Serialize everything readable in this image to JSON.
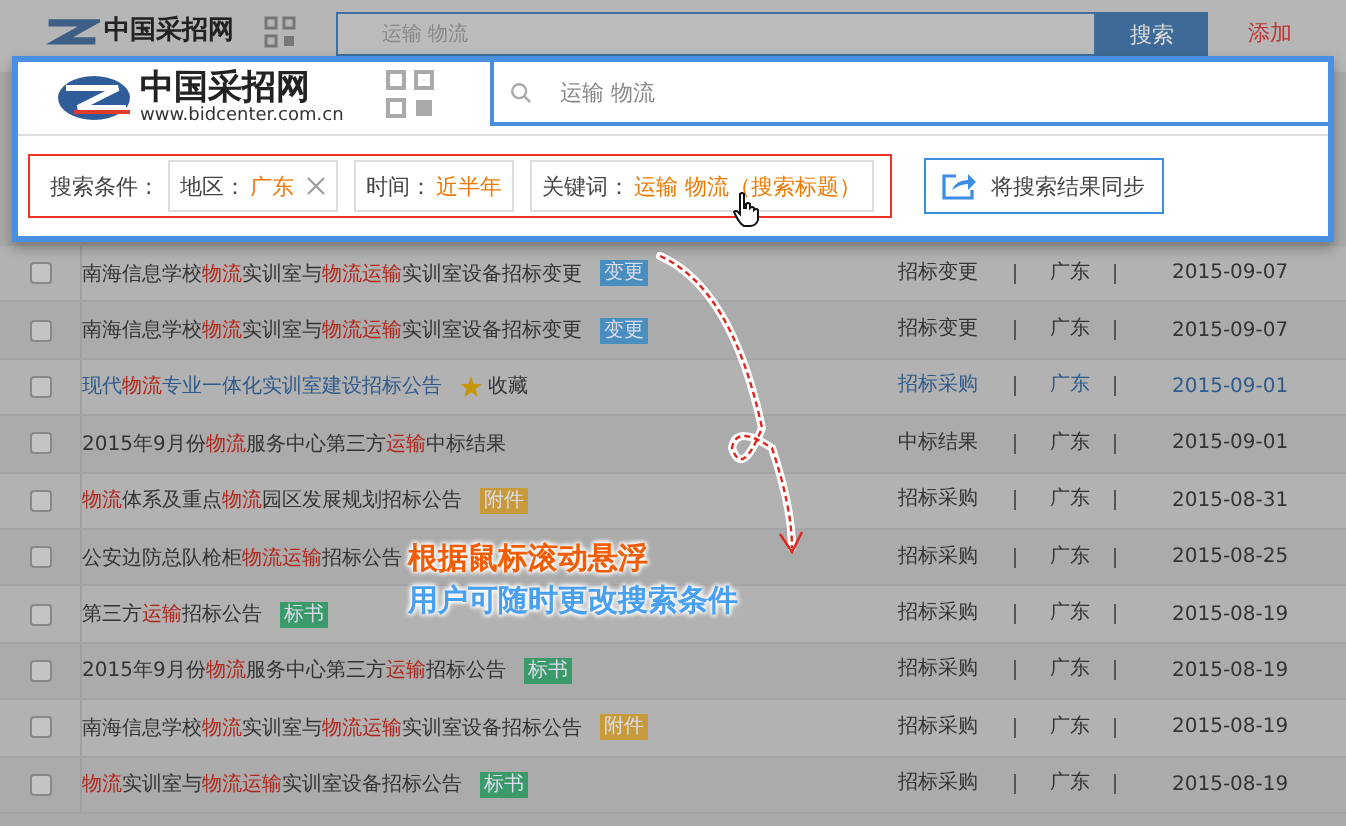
{
  "background_header": {
    "logo": "中国采招网",
    "search_value": "运输 物流",
    "search_button": "搜索",
    "link": "添加"
  },
  "floating_bar": {
    "logo_title": "中国采招网",
    "logo_url": "www.bidcenter.com.cn",
    "search_value": "运输 物流",
    "filter_label": "搜索条件 :",
    "filters": [
      {
        "label": "地区：",
        "value": "广东",
        "removable": true
      },
      {
        "label": "时间：",
        "value": "近半年",
        "removable": false
      },
      {
        "label": "关键词：",
        "value": "运输 物流（搜索标题）",
        "removable": false
      }
    ],
    "sync_button": "将搜索结果同步"
  },
  "rows": [
    {
      "checked": false,
      "highlighted": false,
      "title": [
        {
          "text": "南海信息学校",
          "highlight": false
        },
        {
          "text": "物流",
          "highlight": true
        },
        {
          "text": "实训室与",
          "highlight": false
        },
        {
          "text": "物流运输",
          "highlight": true
        },
        {
          "text": "实训室设备招标变更",
          "highlight": false
        }
      ],
      "tag": {
        "kind": "change",
        "text": "变更"
      },
      "type": "招标变更",
      "region": "广东",
      "date": "2015-09-07"
    },
    {
      "checked": false,
      "highlighted": false,
      "title": [
        {
          "text": "南海信息学校",
          "highlight": false
        },
        {
          "text": "物流",
          "highlight": true
        },
        {
          "text": "实训室与",
          "highlight": false
        },
        {
          "text": "物流运输",
          "highlight": true
        },
        {
          "text": "实训室设备招标变更",
          "highlight": false
        }
      ],
      "tag": {
        "kind": "change",
        "text": "变更"
      },
      "type": "招标变更",
      "region": "广东",
      "date": "2015-09-07"
    },
    {
      "checked": false,
      "highlighted": true,
      "title": [
        {
          "text": "现代",
          "highlight": false
        },
        {
          "text": "物流",
          "highlight": true
        },
        {
          "text": "专业一体化实训室建设招标公告",
          "highlight": false
        }
      ],
      "favorite": "收藏",
      "type": "招标采购",
      "region": "广东",
      "date": "2015-09-01"
    },
    {
      "checked": false,
      "highlighted": false,
      "title": [
        {
          "text": "2015年9月份",
          "highlight": false
        },
        {
          "text": "物流",
          "highlight": true
        },
        {
          "text": "服务中心第三方",
          "highlight": false
        },
        {
          "text": "运输",
          "highlight": true
        },
        {
          "text": "中标结果",
          "highlight": false
        }
      ],
      "type": "中标结果",
      "region": "广东",
      "date": "2015-09-01"
    },
    {
      "checked": false,
      "highlighted": false,
      "title": [
        {
          "text": "物流",
          "highlight": true
        },
        {
          "text": "体系及重点",
          "highlight": false
        },
        {
          "text": "物流",
          "highlight": true
        },
        {
          "text": "园区发展规划招标公告",
          "highlight": false
        }
      ],
      "tag": {
        "kind": "attachment",
        "text": "附件"
      },
      "type": "招标采购",
      "region": "广东",
      "date": "2015-08-31"
    },
    {
      "checked": false,
      "highlighted": false,
      "title": [
        {
          "text": "公安边防总队枪柜",
          "highlight": false
        },
        {
          "text": "物流运输",
          "highlight": true
        },
        {
          "text": "招标公告",
          "highlight": false
        }
      ],
      "type": "招标采购",
      "region": "广东",
      "date": "2015-08-25"
    },
    {
      "checked": false,
      "highlighted": false,
      "title": [
        {
          "text": "第三方",
          "highlight": false
        },
        {
          "text": "运输",
          "highlight": true
        },
        {
          "text": "招标公告",
          "highlight": false
        }
      ],
      "tag": {
        "kind": "document",
        "text": "标书"
      },
      "type": "招标采购",
      "region": "广东",
      "date": "2015-08-19"
    },
    {
      "checked": false,
      "highlighted": false,
      "title": [
        {
          "text": "2015年9月份",
          "highlight": false
        },
        {
          "text": "物流",
          "highlight": true
        },
        {
          "text": "服务中心第三方",
          "highlight": false
        },
        {
          "text": "运输",
          "highlight": true
        },
        {
          "text": "招标公告",
          "highlight": false
        }
      ],
      "tag": {
        "kind": "document",
        "text": "标书"
      },
      "type": "招标采购",
      "region": "广东",
      "date": "2015-08-19"
    },
    {
      "checked": false,
      "highlighted": false,
      "title": [
        {
          "text": "南海信息学校",
          "highlight": false
        },
        {
          "text": "物流",
          "highlight": true
        },
        {
          "text": "实训室与",
          "highlight": false
        },
        {
          "text": "物流运输",
          "highlight": true
        },
        {
          "text": "实训室设备招标公告",
          "highlight": false
        }
      ],
      "tag": {
        "kind": "attachment",
        "text": "附件"
      },
      "type": "招标采购",
      "region": "广东",
      "date": "2015-08-19"
    },
    {
      "checked": false,
      "highlighted": false,
      "title": [
        {
          "text": "物流",
          "highlight": true
        },
        {
          "text": "实训室与",
          "highlight": false
        },
        {
          "text": "物流运输",
          "highlight": true
        },
        {
          "text": "实训室设备招标公告",
          "highlight": false
        }
      ],
      "tag": {
        "kind": "document",
        "text": "标书"
      },
      "type": "招标采购",
      "region": "广东",
      "date": "2015-08-19"
    }
  ],
  "callout": {
    "line_1": "根据鼠标滚动悬浮",
    "line_2": "用户可随时更改搜索条件"
  }
}
